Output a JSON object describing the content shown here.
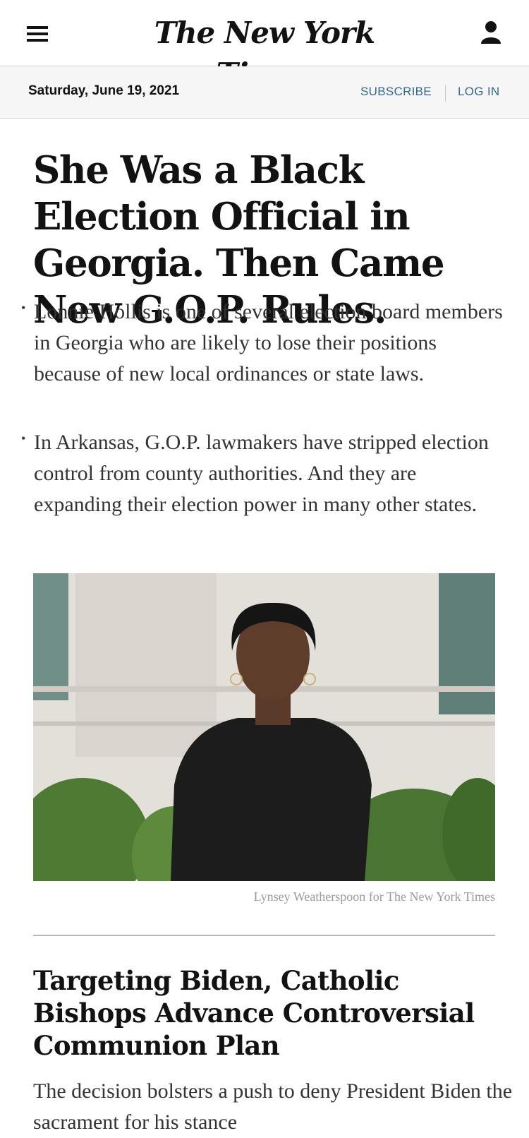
{
  "masthead": {
    "logo_text": "The New York Times",
    "menu_icon": "hamburger-menu-icon",
    "account_icon": "user-account-icon"
  },
  "datebar": {
    "date": "Saturday, June 19, 2021",
    "subscribe_label": "SUBSCRIBE",
    "login_label": "LOG IN"
  },
  "lead_story": {
    "headline": "She Was a Black Election Official in Georgia. Then Came New G.O.P. Rules.",
    "summary": [
      "Lonnie Hollis is one of several election board members in Georgia who are likely to lose their positions because of new local ordinances or state laws.",
      "In Arkansas, G.O.P. lawmakers have stripped election control from county authorities. And they are expanding their election power in many other states."
    ],
    "photo_credit": "Lynsey Weatherspoon for The New York Times"
  },
  "second_story": {
    "headline": "Targeting Biden, Catholic Bishops Advance Controversial Communion Plan",
    "summary": "The decision bolsters a push to deny President Biden the sacrament for his stance"
  },
  "colors": {
    "link_blue": "#326891",
    "text": "#121212",
    "datebar_bg": "#f6f6f6"
  }
}
